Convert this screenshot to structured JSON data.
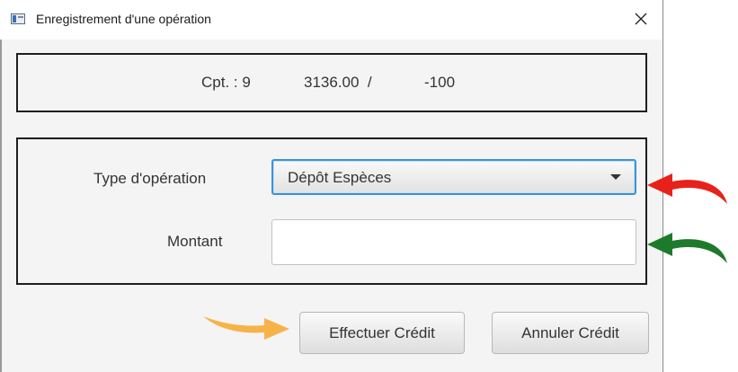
{
  "window": {
    "title": "Enregistrement d'une opération",
    "close_icon": "close-icon"
  },
  "balance": {
    "account": "Cpt. : 9",
    "amount": "3136.00  /",
    "overdraft": "-100"
  },
  "form": {
    "type_label": "Type d'opération",
    "type_value": "Dépôt Espèces",
    "amount_label": "Montant",
    "amount_value": "",
    "amount_placeholder": ""
  },
  "buttons": {
    "submit": "Effectuer Crédit",
    "cancel": "Annuler Crédit"
  },
  "annotations": {
    "colors": {
      "red_arrow": "#e8221b",
      "green_arrow": "#1d7a2b",
      "orange_arrow": "#f8b24a",
      "focus_border": "#3a93d8"
    }
  }
}
